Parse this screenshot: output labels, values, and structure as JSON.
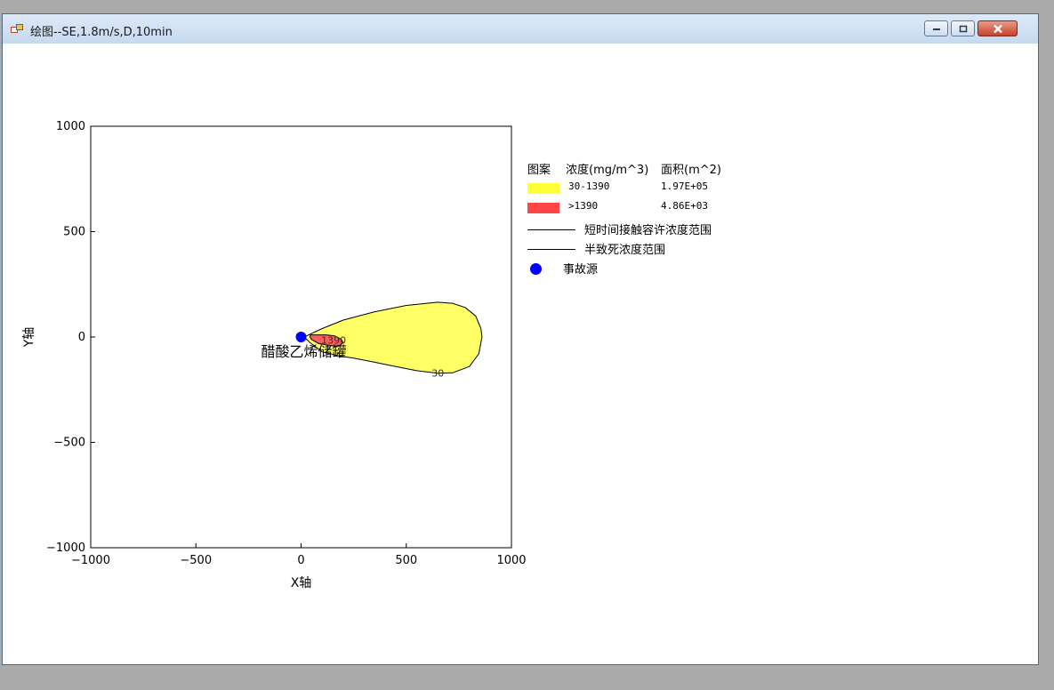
{
  "window": {
    "title": "绘图--SE,1.8m/s,D,10min",
    "icon": "app-window-icon",
    "controls": {
      "minimize_icon": "minimize-icon",
      "maximize_icon": "maximize-icon",
      "close_icon": "close-icon"
    }
  },
  "chart_data": {
    "type": "contour",
    "xlabel": "X轴",
    "ylabel": "Y轴",
    "xlim": [
      -1000,
      1000
    ],
    "ylim": [
      -1000,
      1000
    ],
    "xticks": [
      -1000,
      -500,
      0,
      500,
      1000
    ],
    "yticks": [
      1000,
      500,
      0,
      -500,
      -1000
    ],
    "xtick_labels": [
      "−1000",
      "−500",
      "0",
      "500",
      "1000"
    ],
    "ytick_labels": [
      "1000",
      "500",
      "0",
      "−500",
      "−1000"
    ],
    "source": {
      "x": 0,
      "y": 0,
      "label": "醋酸乙烯储罐",
      "color": "#0000ff"
    },
    "regions": [
      {
        "name": "30-1390",
        "color": "#ffff66",
        "label": "30",
        "label_pos": [
          650,
          -170
        ],
        "outline": [
          [
            25,
            5
          ],
          [
            100,
            40
          ],
          [
            200,
            80
          ],
          [
            350,
            120
          ],
          [
            500,
            150
          ],
          [
            650,
            165
          ],
          [
            720,
            160
          ],
          [
            780,
            140
          ],
          [
            830,
            100
          ],
          [
            855,
            40
          ],
          [
            860,
            0
          ],
          [
            845,
            -80
          ],
          [
            800,
            -140
          ],
          [
            720,
            -170
          ],
          [
            650,
            -172
          ],
          [
            550,
            -160
          ],
          [
            450,
            -140
          ],
          [
            350,
            -120
          ],
          [
            250,
            -100
          ],
          [
            180,
            -90
          ],
          [
            100,
            -70
          ],
          [
            40,
            -25
          ],
          [
            20,
            -5
          ]
        ]
      },
      {
        "name": ">1390",
        "color": "#ff5b5b",
        "label": "1390",
        "label_pos": [
          155,
          -15
        ],
        "outline": [
          [
            45,
            10
          ],
          [
            80,
            10
          ],
          [
            120,
            10
          ],
          [
            160,
            5
          ],
          [
            190,
            -10
          ],
          [
            200,
            -25
          ],
          [
            185,
            -40
          ],
          [
            160,
            -43
          ],
          [
            120,
            -38
          ],
          [
            80,
            -30
          ],
          [
            50,
            -12
          ],
          [
            42,
            0
          ]
        ]
      }
    ],
    "legend": {
      "headers": [
        "图案",
        "浓度(mg/m^3)",
        "面积(m^2)"
      ],
      "items": [
        {
          "label": "30-1390",
          "value": "1.97E+05",
          "color": "#ffff33"
        },
        {
          "label": ">1390",
          "value": "4.86E+03",
          "color": "#ff4545"
        }
      ],
      "line_items": [
        "短时间接触容许浓度范围",
        "半致死浓度范围"
      ],
      "source_item": "事故源"
    }
  }
}
